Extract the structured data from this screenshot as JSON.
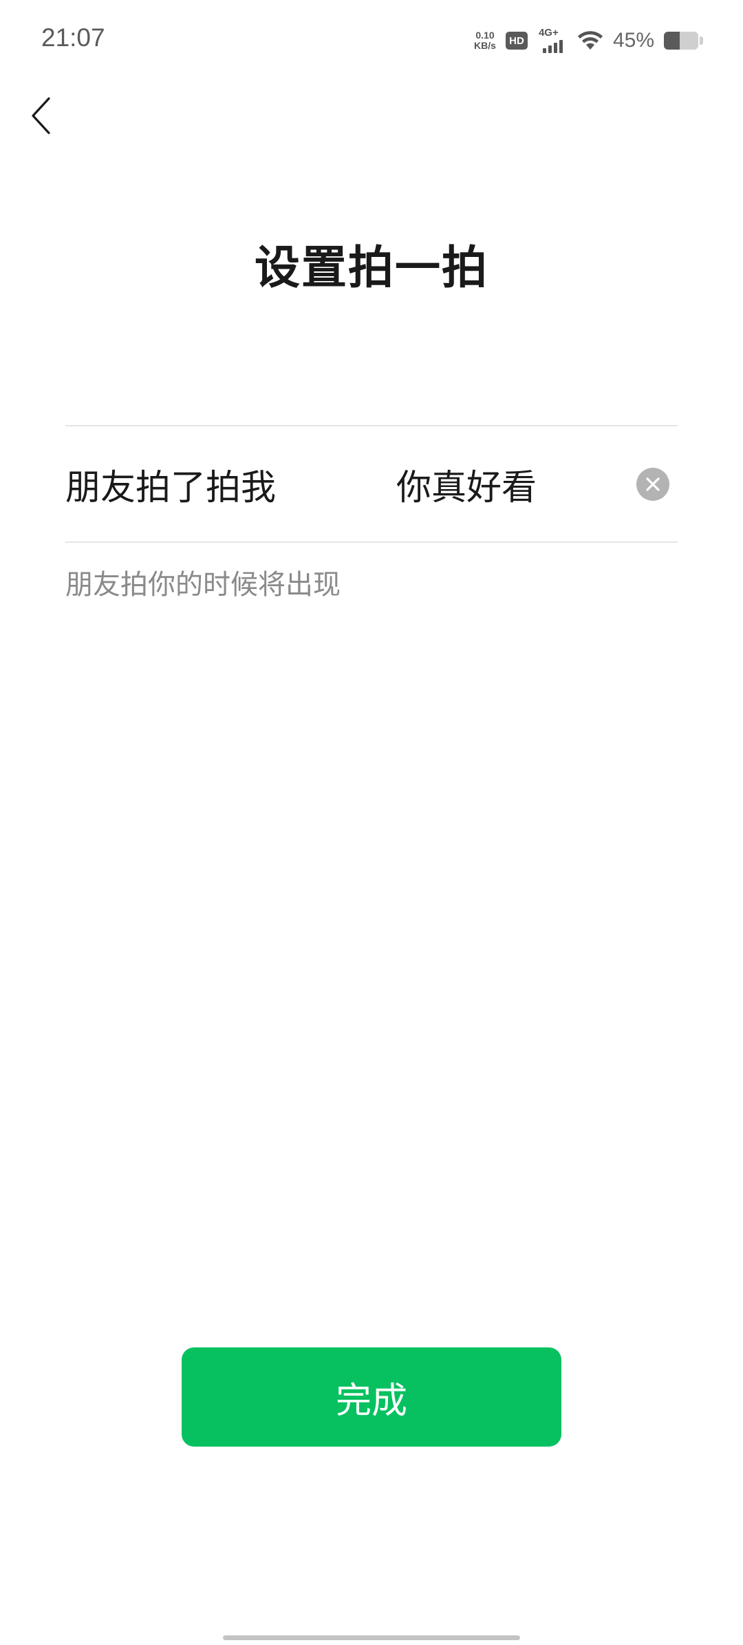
{
  "status_bar": {
    "time": "21:07",
    "net_speed_value": "0.10",
    "net_speed_unit": "KB/s",
    "hd_label": "HD",
    "network_label": "4G+",
    "battery_percent_text": "45%",
    "battery_level": 0.45,
    "icons": [
      "hd-icon",
      "signal-icon",
      "wifi-icon",
      "battery-icon"
    ]
  },
  "nav": {
    "back_icon": "chevron-left-icon"
  },
  "page": {
    "title": "设置拍一拍"
  },
  "pat_setting": {
    "prefix_label": "朋友拍了拍我",
    "suffix_value": "你真好看",
    "clear_icon": "clear-circle-icon",
    "hint": "朋友拍你的时候将出现"
  },
  "actions": {
    "done_label": "完成"
  },
  "colors": {
    "primary_green": "#07c160",
    "text_primary": "#1a1a1a",
    "text_secondary": "#8a8a8a",
    "divider": "#e5e5e5"
  }
}
